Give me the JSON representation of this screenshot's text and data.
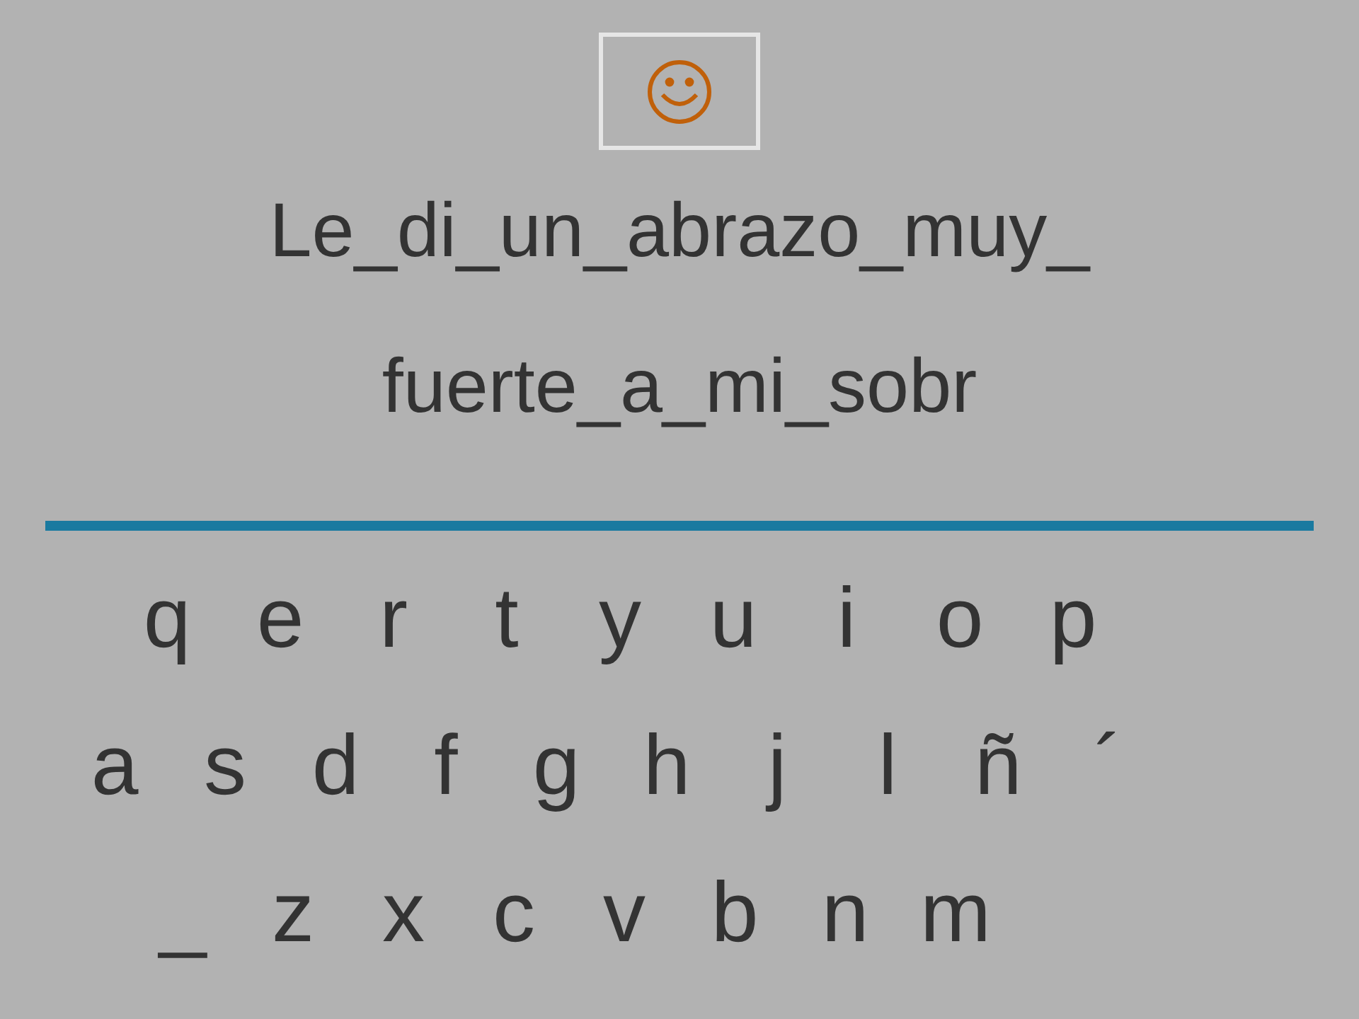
{
  "sentence_lines": [
    "Le_di_un_abrazo_muy_",
    "fuerte_a_mi_sobr"
  ],
  "keyboard_rows": [
    [
      "q",
      "e",
      "r",
      "t",
      "y",
      "u",
      "i",
      "o",
      "p"
    ],
    [
      "a",
      "s",
      "d",
      "f",
      "g",
      "h",
      "j",
      "l",
      "ñ",
      "´"
    ],
    [
      "_",
      "z",
      "x",
      "c",
      "v",
      "b",
      "n",
      "m"
    ]
  ]
}
